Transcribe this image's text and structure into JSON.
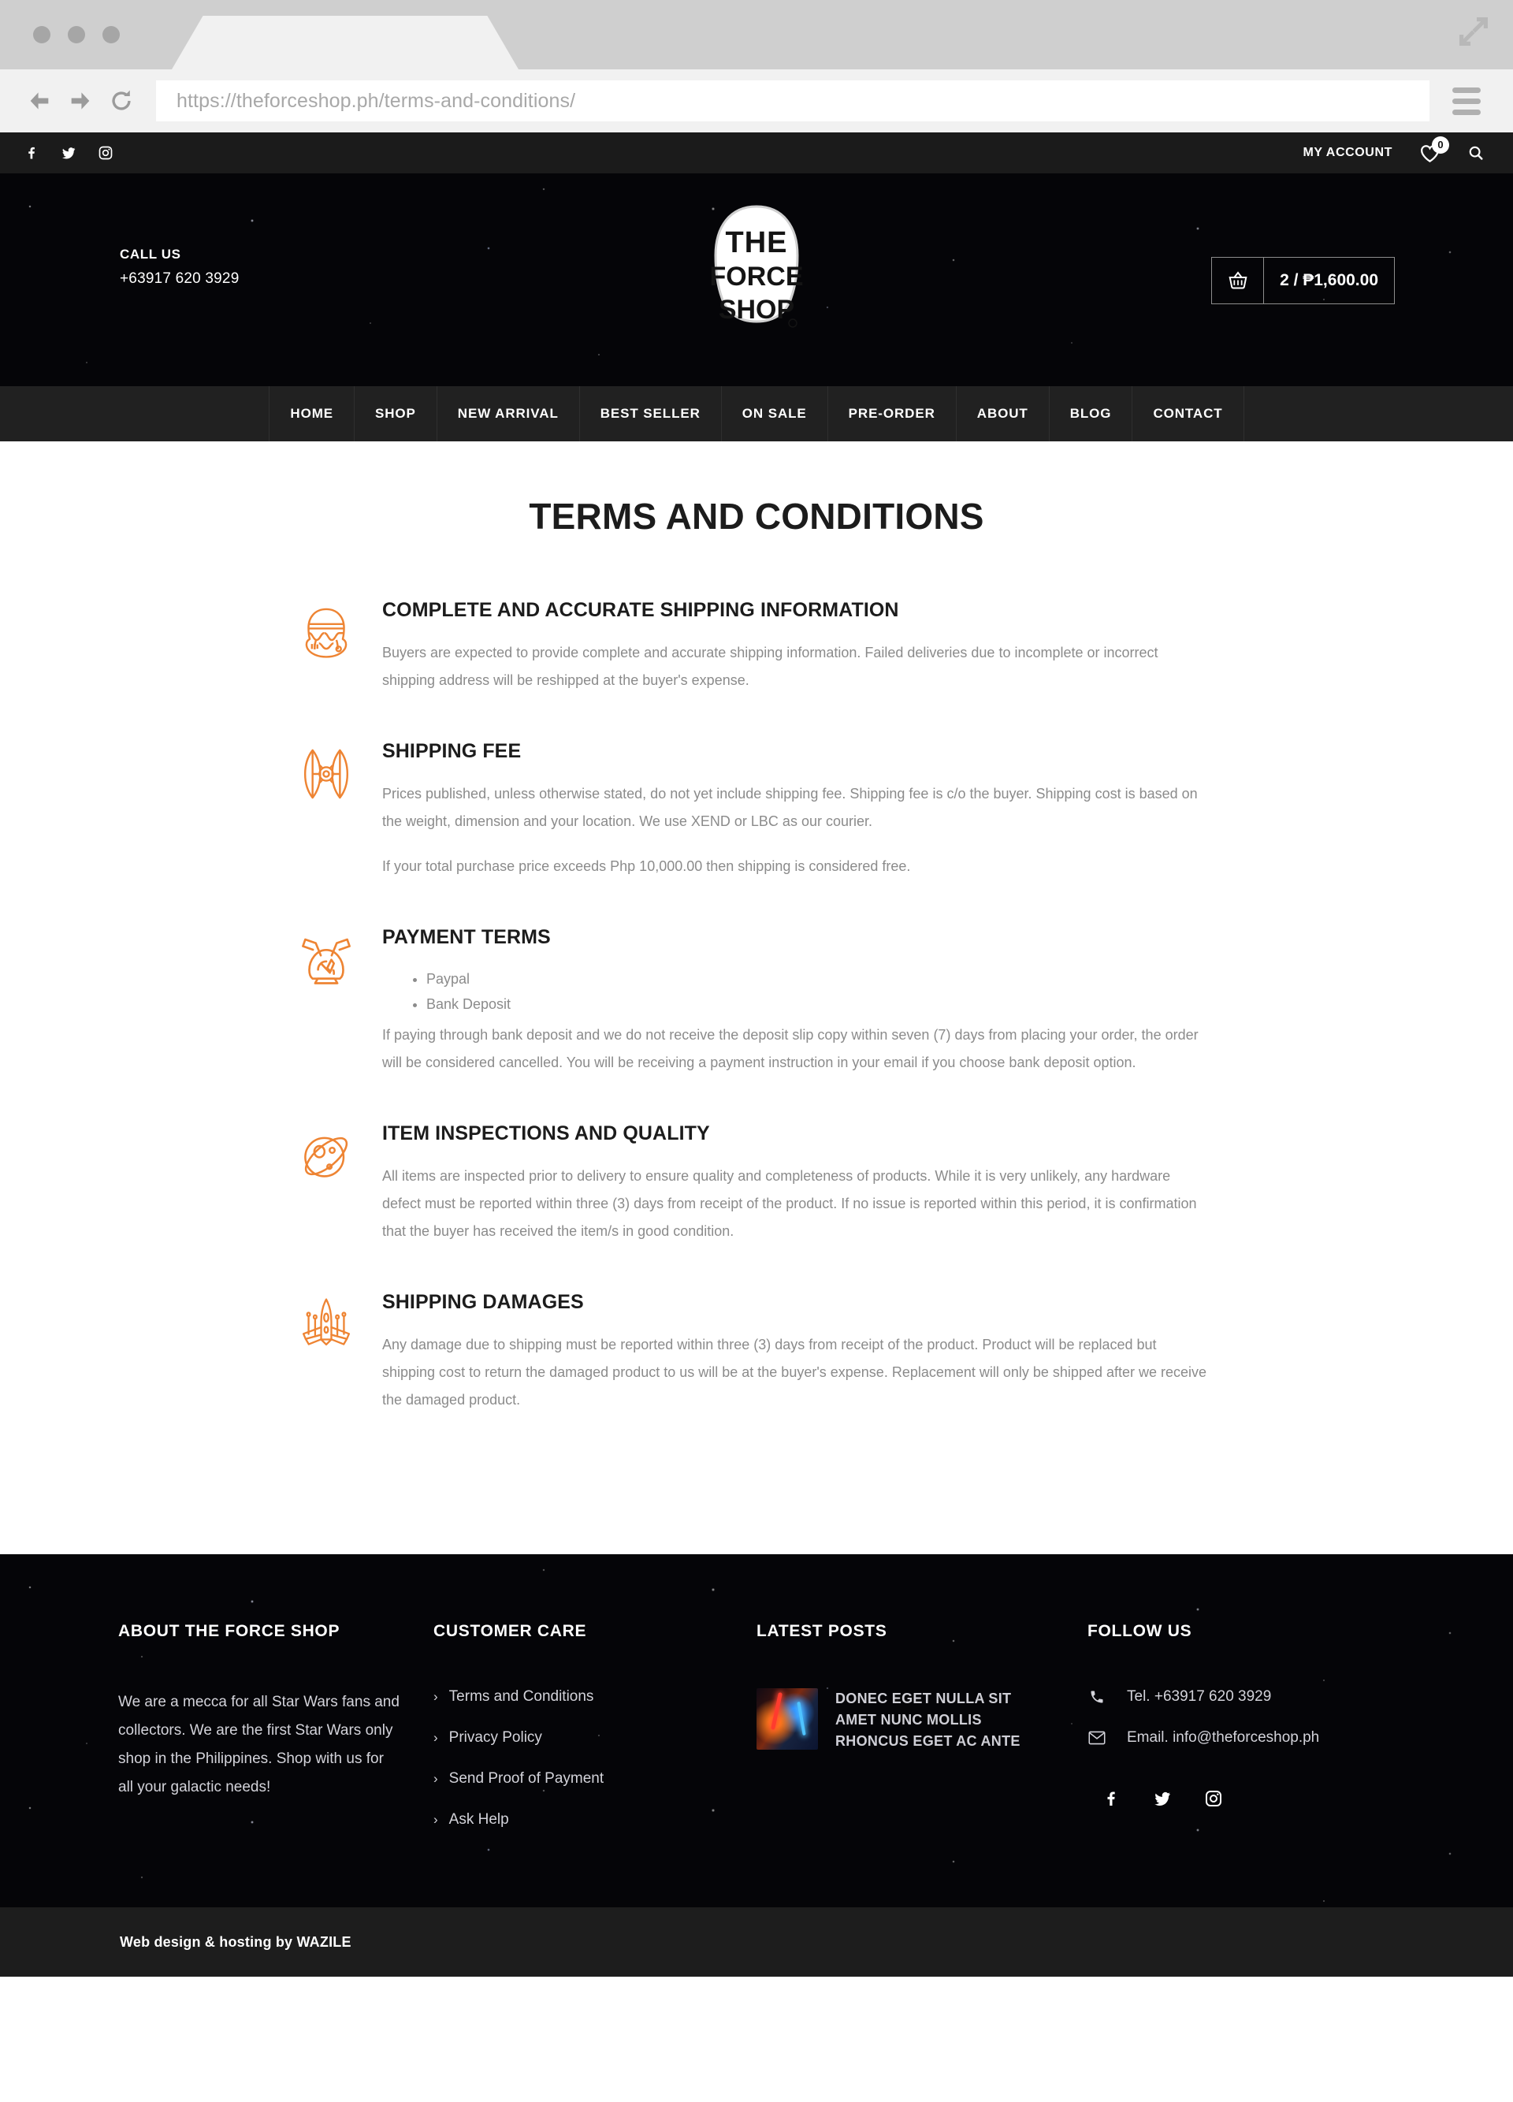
{
  "browser": {
    "url": "https://theforceshop.ph/terms-and-conditions/",
    "back_label": "←",
    "forward_label": "→",
    "reload_label": "⟳",
    "menu_name": "hamburger-menu",
    "expand_name": "expand-icon"
  },
  "topbar": {
    "social": [
      {
        "name": "facebook-icon",
        "label": "f"
      },
      {
        "name": "twitter-icon",
        "label": "t"
      },
      {
        "name": "instagram-icon",
        "label": "i"
      }
    ],
    "my_account": "MY ACCOUNT",
    "wishlist_count": "0",
    "search_label": "Search"
  },
  "masthead": {
    "call_us_label": "CALL US",
    "phone": "+63917 620 3929",
    "logo_line1": "THE",
    "logo_line2": "FORCE",
    "logo_line3": "SHOP",
    "logo_alt": "The Force Shop",
    "cart_text": "2 / ₱1,600.00"
  },
  "nav": {
    "items": [
      {
        "label": "HOME"
      },
      {
        "label": "SHOP"
      },
      {
        "label": "NEW ARRIVAL"
      },
      {
        "label": "BEST SELLER"
      },
      {
        "label": "ON SALE"
      },
      {
        "label": "PRE-ORDER"
      },
      {
        "label": "ABOUT"
      },
      {
        "label": "BLOG"
      },
      {
        "label": "CONTACT"
      }
    ]
  },
  "page": {
    "title": "TERMS AND CONDITIONS",
    "sections": [
      {
        "icon": "stormtrooper-helmet-icon",
        "title": "COMPLETE AND ACCURATE SHIPPING INFORMATION",
        "paragraphs": [
          "Buyers are expected to provide complete and accurate shipping information. Failed deliveries due to incomplete or incorrect shipping address will be reshipped at the buyer's expense."
        ],
        "bullets": []
      },
      {
        "icon": "tie-fighter-icon",
        "title": "SHIPPING FEE",
        "paragraphs": [
          "Prices published, unless otherwise stated, do not yet include shipping fee. Shipping fee is c/o the buyer. Shipping cost is based on the weight, dimension and your location. We use XEND or LBC as our courier.",
          "If your total purchase price exceeds Php 10,000.00 then shipping is considered free."
        ],
        "bullets": []
      },
      {
        "icon": "droid-head-icon",
        "title": "PAYMENT TERMS",
        "bullets": [
          "Paypal",
          "Bank Deposit"
        ],
        "paragraphs": [
          "If paying through bank deposit and we do not receive the deposit slip copy within seven (7) days from placing your order, the order will be considered cancelled. You will be receiving a payment instruction in your email if you choose bank deposit option."
        ]
      },
      {
        "icon": "death-star-icon",
        "title": "ITEM INSPECTIONS AND QUALITY",
        "paragraphs": [
          "All items are inspected prior to delivery to ensure quality and completeness of products. While it is very unlikely, any hardware defect must be reported within three (3) days from receipt of the product. If no issue is reported within this period, it is confirmation that the buyer has received the item/s in good condition."
        ],
        "bullets": []
      },
      {
        "icon": "x-wing-icon",
        "title": "SHIPPING DAMAGES",
        "paragraphs": [
          "Any damage due to shipping must be reported within three (3) days from receipt of the product. Product will be replaced but shipping cost to return the damaged product to us will be at the buyer's expense. Replacement will only be shipped after we receive the damaged product."
        ],
        "bullets": []
      }
    ]
  },
  "footer": {
    "about": {
      "heading": "ABOUT THE FORCE SHOP",
      "text": "We are a mecca for all Star Wars fans and collectors. We are the first Star Wars only shop in the Philippines. Shop with us for all your galactic needs!"
    },
    "care": {
      "heading": "CUSTOMER CARE",
      "links": [
        "Terms and Conditions",
        "Privacy Policy",
        "Send Proof of Payment",
        "Ask Help"
      ]
    },
    "posts": {
      "heading": "LATEST POSTS",
      "items": [
        {
          "title": "DONEC EGET NULLA SIT AMET NUNC MOLLIS RHONCUS EGET AC ANTE"
        }
      ]
    },
    "follow": {
      "heading": "FOLLOW US",
      "tel": "Tel. +63917 620 3929",
      "email": "Email. info@theforceshop.ph",
      "social": [
        {
          "name": "facebook-icon"
        },
        {
          "name": "twitter-icon"
        },
        {
          "name": "instagram-icon"
        }
      ]
    }
  },
  "bottombar": {
    "credit": "Web design & hosting by WAZILE"
  },
  "colors": {
    "accent_orange": "#ee8433",
    "dark_bar": "#1b1b1b",
    "nav_bar": "#212121",
    "body_text": "#8b8b8b"
  }
}
